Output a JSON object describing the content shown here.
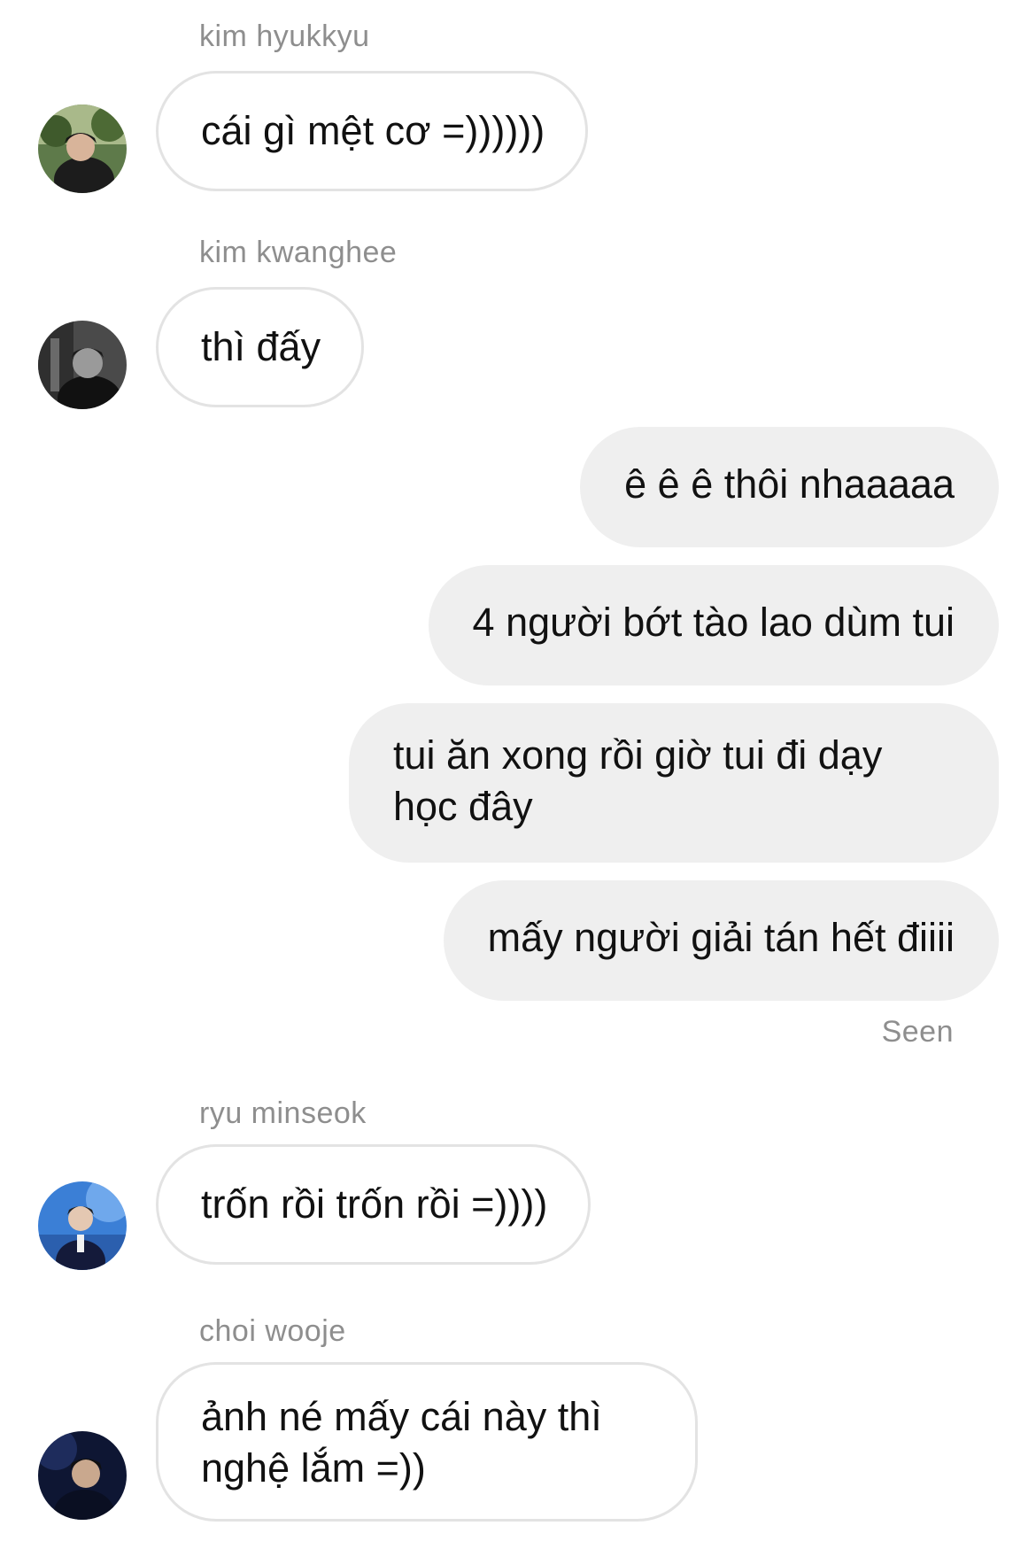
{
  "conversation": {
    "messages": [
      {
        "sender": "kim hyukkyu",
        "text": "cái gì mệt cơ =))))))",
        "direction": "incoming",
        "avatar": "avatar-hyukkyu"
      },
      {
        "sender": "kim kwanghee",
        "text": "thì đấy",
        "direction": "incoming",
        "avatar": "avatar-kwanghee"
      },
      {
        "text": "ê ê ê thôi nhaaaaa",
        "direction": "outgoing"
      },
      {
        "text": "4 người bớt tào lao dùm tui",
        "direction": "outgoing"
      },
      {
        "text": "tui ăn xong rồi giờ tui đi dạy học đây",
        "direction": "outgoing"
      },
      {
        "text": "mấy người giải tán hết điiii",
        "direction": "outgoing"
      },
      {
        "sender": "ryu minseok",
        "text": "trốn rồi trốn rồi =))))",
        "direction": "incoming",
        "avatar": "avatar-minseok"
      },
      {
        "sender": "choi wooje",
        "text": "ảnh né mấy cái này thì nghệ lắm =))",
        "direction": "incoming",
        "avatar": "avatar-wooje"
      }
    ],
    "seen_label": "Seen"
  },
  "colors": {
    "incoming_border": "#e3e3e3",
    "outgoing_bg": "#efefef",
    "meta_text": "#8e8e8e",
    "message_text": "#111111"
  }
}
